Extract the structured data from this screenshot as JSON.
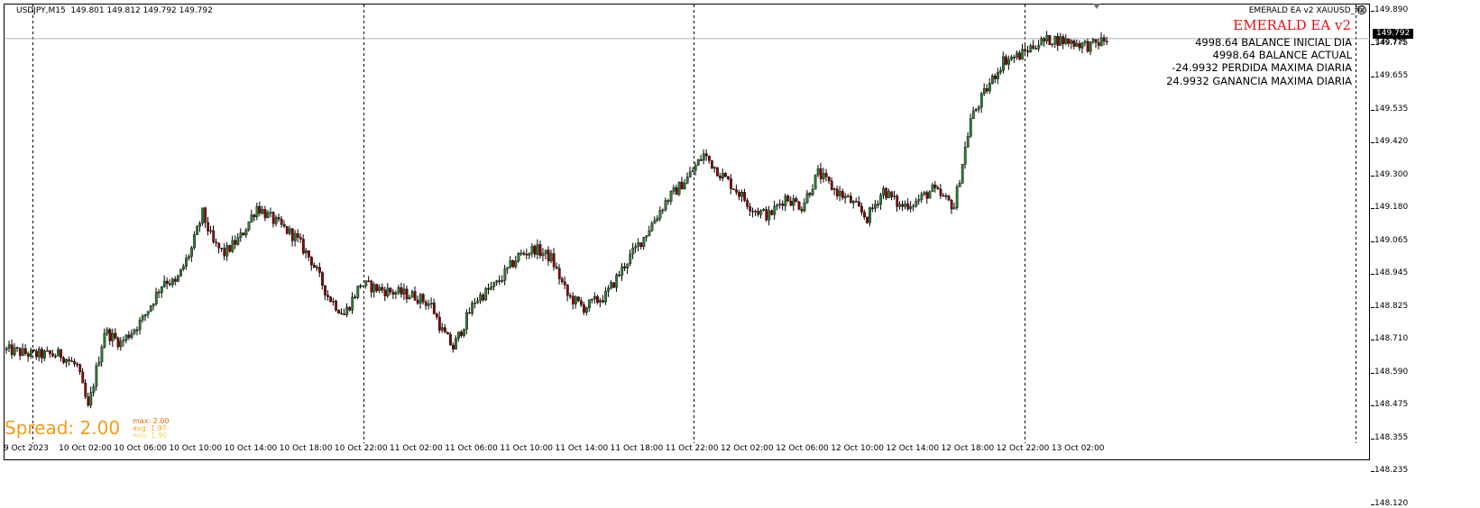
{
  "symbol_info": "USDJPY,M15  149.801 149.812 149.792 149.792",
  "ea": {
    "label": "EMERALD EA  v2 XAUUSD_fix",
    "face_icon": "smiley-icon",
    "title": "EMERALD EA v2",
    "title_color": "#e01010"
  },
  "stats": [
    "4998.64 BALANCE INICIAL DIA",
    "4998.64 BALANCE ACTUAL",
    "-24.9932 PERDIDA MAXIMA DIARIA",
    "24.9932 GANANCIA MAXIMA DIARIA"
  ],
  "spread": {
    "label": "Spread: 2.00",
    "max": "max: 2.00",
    "avg": "avg: 1.97",
    "min": "min: 1.90",
    "color": "#f39b1b"
  },
  "price_axis": {
    "current": "149.792",
    "current_sub": "149.775",
    "labels": [
      "149.890",
      "149.775",
      "149.655",
      "149.535",
      "149.420",
      "149.300",
      "149.180",
      "149.065",
      "148.945",
      "148.825",
      "148.710",
      "148.590",
      "148.475",
      "148.355",
      "148.235",
      "148.120"
    ]
  },
  "time_axis": {
    "labels": [
      "9 Oct 2023",
      "10 Oct 02:00",
      "10 Oct 06:00",
      "10 Oct 10:00",
      "10 Oct 14:00",
      "10 Oct 18:00",
      "10 Oct 22:00",
      "11 Oct 02:00",
      "11 Oct 06:00",
      "11 Oct 10:00",
      "11 Oct 14:00",
      "11 Oct 18:00",
      "11 Oct 22:00",
      "12 Oct 02:00",
      "12 Oct 06:00",
      "12 Oct 10:00",
      "12 Oct 14:00",
      "12 Oct 18:00",
      "12 Oct 22:00",
      "13 Oct 02:00"
    ]
  },
  "chart_data": {
    "type": "candlestick",
    "symbol": "USDJPY",
    "timeframe": "M15",
    "ylim": [
      148.09,
      149.91
    ],
    "bull_color": "#2e7d32",
    "bear_color": "#8b0000",
    "current_price": 149.792,
    "anchors": [
      [
        0,
        148.47
      ],
      [
        10,
        148.45
      ],
      [
        20,
        148.45
      ],
      [
        26,
        148.4
      ],
      [
        30,
        148.22
      ],
      [
        36,
        148.55
      ],
      [
        42,
        148.5
      ],
      [
        50,
        148.6
      ],
      [
        58,
        148.77
      ],
      [
        62,
        148.75
      ],
      [
        68,
        148.9
      ],
      [
        72,
        149.05
      ],
      [
        76,
        148.92
      ],
      [
        80,
        148.88
      ],
      [
        86,
        148.95
      ],
      [
        92,
        149.08
      ],
      [
        98,
        149.02
      ],
      [
        106,
        148.95
      ],
      [
        112,
        148.85
      ],
      [
        118,
        148.7
      ],
      [
        124,
        148.62
      ],
      [
        130,
        148.75
      ],
      [
        140,
        148.72
      ],
      [
        150,
        148.7
      ],
      [
        156,
        148.66
      ],
      [
        160,
        148.55
      ],
      [
        164,
        148.48
      ],
      [
        172,
        148.68
      ],
      [
        180,
        148.75
      ],
      [
        188,
        148.87
      ],
      [
        194,
        148.9
      ],
      [
        200,
        148.86
      ],
      [
        206,
        148.7
      ],
      [
        212,
        148.65
      ],
      [
        220,
        148.7
      ],
      [
        228,
        148.85
      ],
      [
        234,
        148.95
      ],
      [
        242,
        149.1
      ],
      [
        250,
        149.2
      ],
      [
        256,
        149.3
      ],
      [
        262,
        149.22
      ],
      [
        268,
        149.15
      ],
      [
        274,
        149.07
      ],
      [
        280,
        149.04
      ],
      [
        286,
        149.12
      ],
      [
        292,
        149.08
      ],
      [
        298,
        149.22
      ],
      [
        304,
        149.15
      ],
      [
        310,
        149.1
      ],
      [
        316,
        149.03
      ],
      [
        322,
        149.15
      ],
      [
        328,
        149.08
      ],
      [
        334,
        149.1
      ],
      [
        340,
        149.15
      ],
      [
        348,
        149.08
      ],
      [
        354,
        149.45
      ],
      [
        360,
        149.58
      ],
      [
        366,
        149.7
      ],
      [
        372,
        149.72
      ],
      [
        378,
        149.77
      ],
      [
        384,
        149.79
      ],
      [
        390,
        149.78
      ],
      [
        398,
        149.76
      ],
      [
        404,
        149.79
      ]
    ],
    "day_separators": [
      "10 Oct 00:00",
      "11 Oct 00:00",
      "12 Oct 00:00",
      "13 Oct 00:00",
      "14 Oct 00:00"
    ],
    "grid": false
  }
}
